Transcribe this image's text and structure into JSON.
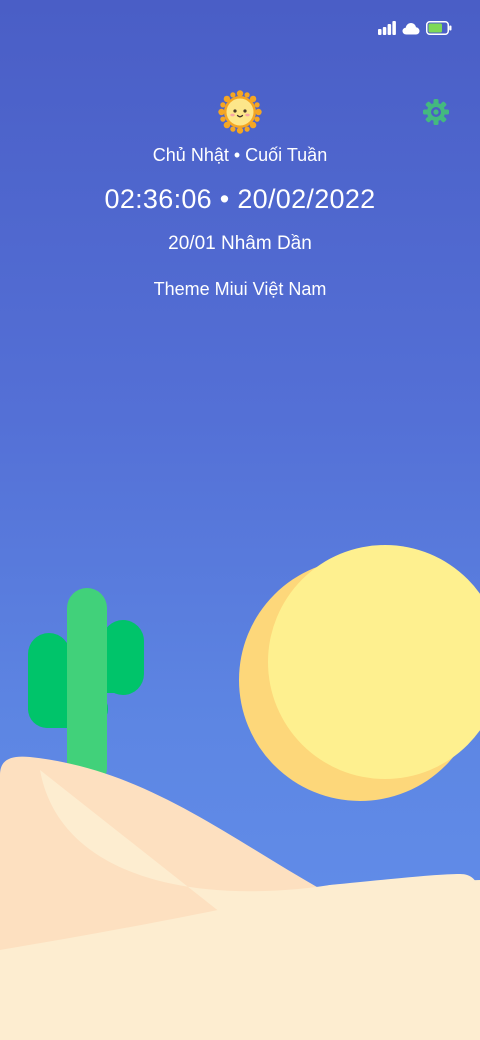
{
  "status_bar": {
    "signal_icon": "signal-bars-icon",
    "cloud_icon": "cloud-icon",
    "battery_icon": "battery-icon",
    "battery_level": 0.75,
    "battery_color": "#7ed957"
  },
  "widget": {
    "sun_icon": "smiling-sun-icon",
    "settings_icon": "gear-icon",
    "settings_color": "#43b97f",
    "day_text": "Chủ Nhật • Cuối Tuần",
    "clock_text": "02:36:06 • 20/02/2022",
    "lunar_text": "20/01 Nhâm Dần",
    "brand_text": "Theme Miui Việt Nam"
  },
  "wallpaper": {
    "sky_top": "#4a5ec6",
    "sky_bottom": "#6490ec",
    "sun_color": "#fdea8b",
    "sun_shade": "#fdd77a",
    "cactus_light": "#41d17a",
    "cactus_dark": "#00c46a",
    "dune_back": "#fde0c0",
    "dune_front": "#fdedd0"
  }
}
